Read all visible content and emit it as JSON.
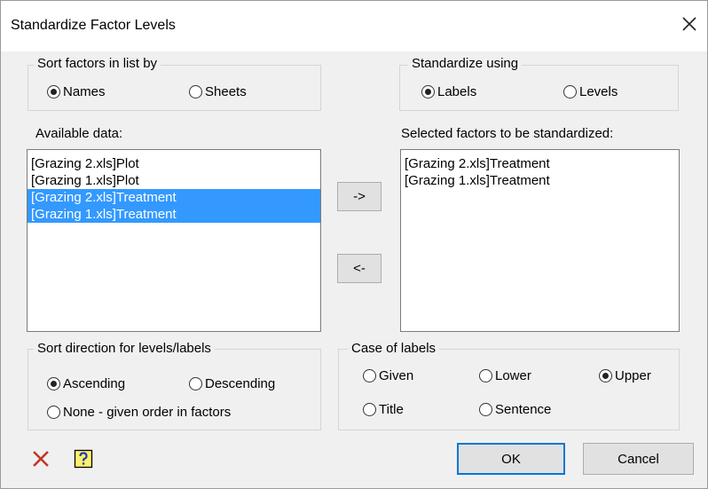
{
  "window": {
    "title": "Standardize Factor Levels"
  },
  "sort_factors": {
    "legend": "Sort factors in list by",
    "options": [
      {
        "label": "Names",
        "checked": true
      },
      {
        "label": "Sheets",
        "checked": false
      }
    ]
  },
  "standardize_using": {
    "legend": "Standardize using",
    "options": [
      {
        "label": "Labels",
        "checked": true
      },
      {
        "label": "Levels",
        "checked": false
      }
    ]
  },
  "available": {
    "label": "Available data:",
    "items": [
      {
        "text": "[Grazing 2.xls]Plot",
        "selected": false
      },
      {
        "text": "[Grazing 1.xls]Plot",
        "selected": false
      },
      {
        "text": "[Grazing 2.xls]Treatment",
        "selected": true
      },
      {
        "text": "[Grazing 1.xls]Treatment",
        "selected": true
      }
    ]
  },
  "selected_factors": {
    "label": "Selected factors to be standardized:",
    "items": [
      {
        "text": "[Grazing 2.xls]Treatment"
      },
      {
        "text": "[Grazing 1.xls]Treatment"
      }
    ]
  },
  "transfer": {
    "add_label": "->",
    "remove_label": "<-"
  },
  "sort_direction": {
    "legend": "Sort direction for levels/labels",
    "options": [
      {
        "label": "Ascending",
        "checked": true
      },
      {
        "label": "Descending",
        "checked": false
      },
      {
        "label": "None - given order in factors",
        "checked": false
      }
    ]
  },
  "case_of_labels": {
    "legend": "Case of labels",
    "options": [
      {
        "label": "Given",
        "checked": false
      },
      {
        "label": "Lower",
        "checked": false
      },
      {
        "label": "Upper",
        "checked": true
      },
      {
        "label": "Title",
        "checked": false
      },
      {
        "label": "Sentence",
        "checked": false
      }
    ]
  },
  "footer": {
    "clear_icon": "red-x-icon",
    "help_icon": "help-question-icon",
    "ok_label": "OK",
    "cancel_label": "Cancel"
  },
  "colors": {
    "selection": "#3399ff",
    "default_button_border": "#0078d7",
    "clear_icon": "#c0392b",
    "help_icon": "#1a3fb0"
  }
}
